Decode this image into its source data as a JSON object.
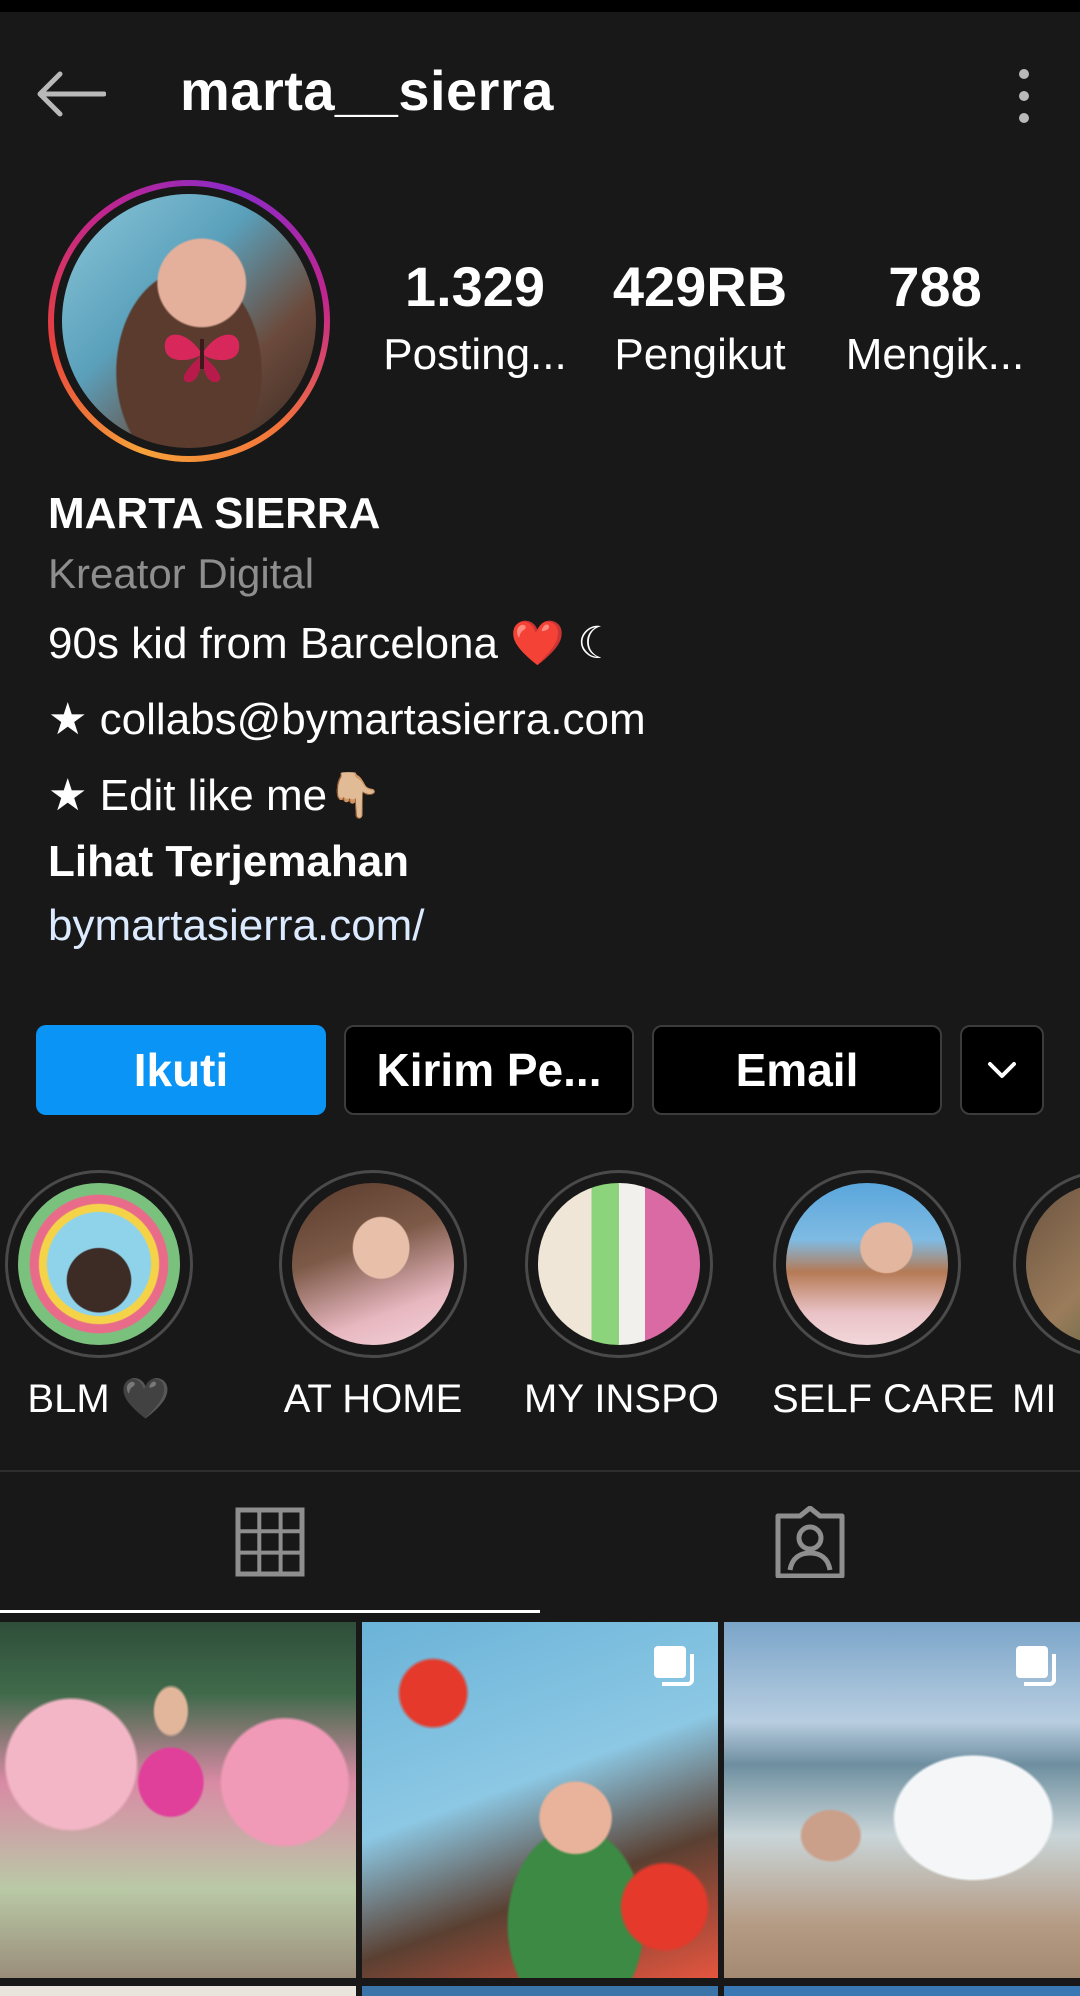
{
  "header": {
    "username": "marta__sierra"
  },
  "stats": [
    {
      "value": "1.329",
      "label": "Posting..."
    },
    {
      "value": "429RB",
      "label": "Pengikut"
    },
    {
      "value": "788",
      "label": "Mengik..."
    }
  ],
  "bio": {
    "name": "MARTA SIERRA",
    "category": "Kreator Digital",
    "line1": "90s kid from Barcelona ❤️ ☾",
    "line2": "★ collabs@bymartasierra.com",
    "line3": "★ Edit like me👇🏼",
    "translate": "Lihat Terjemahan",
    "link": "bymartasierra.com/"
  },
  "buttons": {
    "follow": "Ikuti",
    "message": "Kirim Pe...",
    "email": "Email"
  },
  "highlights": [
    {
      "label": "BLM 🖤"
    },
    {
      "label": "AT HOME"
    },
    {
      "label": "MY INSPO"
    },
    {
      "label": "SELF CARE"
    },
    {
      "label": "MI"
    }
  ],
  "tabs": {
    "active": "grid",
    "items": [
      "grid-icon",
      "tagged-icon"
    ]
  },
  "colors": {
    "background": "#181818",
    "primary_button": "#0a95f6",
    "category_text": "#8e8e8e",
    "link_text": "#dbeafe"
  }
}
